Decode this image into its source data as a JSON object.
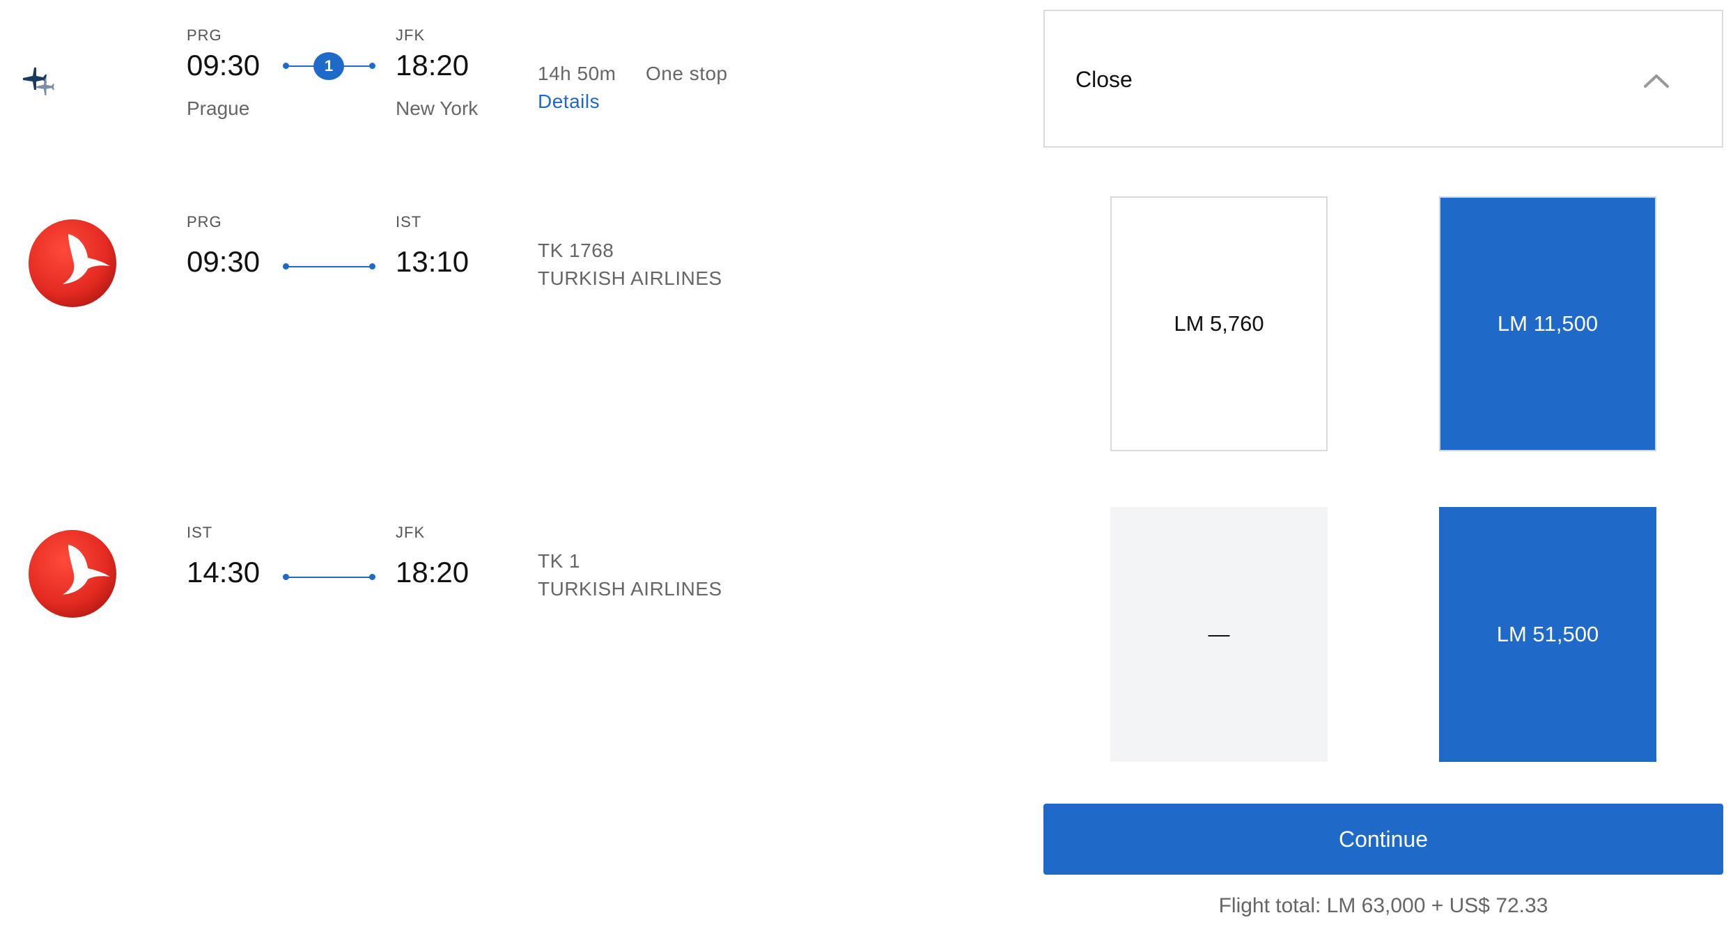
{
  "summary": {
    "origin_code": "PRG",
    "origin_time": "09:30",
    "origin_city": "Prague",
    "dest_code": "JFK",
    "dest_time": "18:20",
    "dest_city": "New York",
    "stops_count": "1",
    "duration": "14h 50m",
    "stops_label": "One stop",
    "details_link": "Details",
    "icon": "connecting-flights-icon"
  },
  "segments": [
    {
      "from_code": "PRG",
      "from_time": "09:30",
      "to_code": "IST",
      "to_time": "13:10",
      "flight_number": "TK 1768",
      "airline": "TURKISH AIRLINES",
      "logo": "turkish-airlines-logo"
    },
    {
      "from_code": "IST",
      "from_time": "14:30",
      "to_code": "JFK",
      "to_time": "18:20",
      "flight_number": "TK 1",
      "airline": "TURKISH AIRLINES",
      "logo": "turkish-airlines-logo"
    }
  ],
  "panel": {
    "close_label": "Close",
    "chevron_icon": "chevron-up-icon"
  },
  "fares": [
    {
      "economy": "LM 5,760",
      "business": "LM 11,500"
    },
    {
      "economy": "—",
      "business": "LM 51,500"
    }
  ],
  "footer": {
    "continue_label": "Continue",
    "flight_total": "Flight total: LM 63,000 + US$ 72.33"
  },
  "colors": {
    "accent": "#1f69c9",
    "unavailable": "#f3f4f5",
    "turkish_red": "#e42a22"
  }
}
